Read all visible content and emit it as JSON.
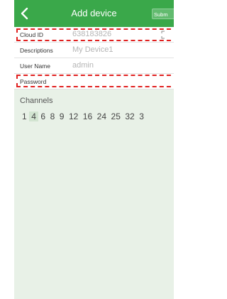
{
  "header": {
    "title": "Add device",
    "submit_label": "Subm",
    "back_icon": "chevron-left-icon"
  },
  "form": {
    "cloud_id": {
      "label": "Cloud ID",
      "value": "638183826",
      "icon": "qr-scan-icon"
    },
    "descriptions": {
      "label": "Descriptions",
      "value": "My Device1"
    },
    "user_name": {
      "label": "User Name",
      "value": "admin"
    },
    "password": {
      "label": "Password",
      "value": ""
    }
  },
  "channels": {
    "title": "Channels",
    "options": [
      "1",
      "4",
      "6",
      "8",
      "9",
      "12",
      "16",
      "24",
      "25",
      "32",
      "3"
    ],
    "selected": "4"
  },
  "colors": {
    "accent": "#3aa84a",
    "highlight": "#e0201f",
    "background": "#e8f1e7"
  }
}
